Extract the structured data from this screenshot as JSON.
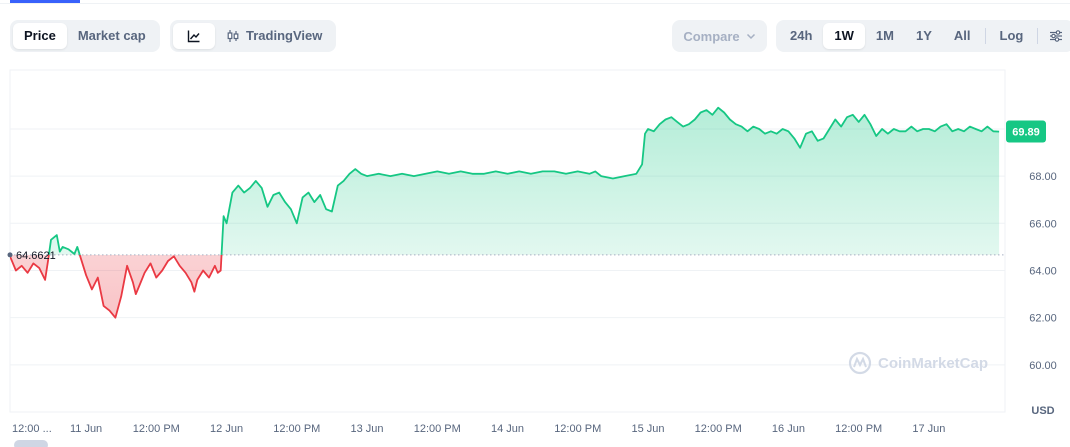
{
  "tabs": [
    {
      "label": "Price",
      "active": true
    },
    {
      "label": "Market cap",
      "active": false
    }
  ],
  "view_buttons": {
    "line_icon": "line-chart-icon",
    "tradingview_icon": "candlestick-icon",
    "tradingview_label": "TradingView"
  },
  "compare": {
    "label": "Compare",
    "icon": "chevron-down-icon"
  },
  "ranges": [
    {
      "label": "24h",
      "active": false
    },
    {
      "label": "1W",
      "active": true
    },
    {
      "label": "1M",
      "active": false
    },
    {
      "label": "1Y",
      "active": false
    },
    {
      "label": "All",
      "active": false
    }
  ],
  "log_label": "Log",
  "settings_icon": "sliders-icon",
  "watermark": "CoinMarketCap",
  "colors": {
    "up": "#16c784",
    "down": "#ea3943",
    "badge": "#16c784",
    "accent": "#3861fb"
  },
  "chart_data": {
    "type": "area",
    "reference_value": 64.6621,
    "reference_label": "64.6621",
    "current_value": 69.89,
    "current_label": "69.89",
    "currency": "USD",
    "ylim": [
      58.0,
      72.5
    ],
    "y_ticks": [
      {
        "value": 60.0,
        "label": "60.00"
      },
      {
        "value": 62.0,
        "label": "62.00"
      },
      {
        "value": 64.0,
        "label": "64.00"
      },
      {
        "value": 66.0,
        "label": "66.00"
      },
      {
        "value": 68.0,
        "label": "68.00"
      }
    ],
    "x_ticks": [
      {
        "x": 0,
        "label": "12:00 ..."
      },
      {
        "x": 12,
        "label": "11 Jun"
      },
      {
        "x": 24,
        "label": "12:00 PM"
      },
      {
        "x": 36,
        "label": "12 Jun"
      },
      {
        "x": 48,
        "label": "12:00 PM"
      },
      {
        "x": 60,
        "label": "13 Jun"
      },
      {
        "x": 72,
        "label": "12:00 PM"
      },
      {
        "x": 84,
        "label": "14 Jun"
      },
      {
        "x": 96,
        "label": "12:00 PM"
      },
      {
        "x": 108,
        "label": "15 Jun"
      },
      {
        "x": 120,
        "label": "12:00 PM"
      },
      {
        "x": 132,
        "label": "16 Jun"
      },
      {
        "x": 144,
        "label": "12:00 PM"
      },
      {
        "x": 156,
        "label": "17 Jun"
      }
    ],
    "xlim": [
      -1,
      169
    ],
    "points": [
      [
        -1.0,
        64.6
      ],
      [
        0.0,
        64.0
      ],
      [
        1.0,
        64.2
      ],
      [
        2.0,
        63.9
      ],
      [
        3.0,
        64.3
      ],
      [
        4.0,
        64.1
      ],
      [
        5.0,
        63.6
      ],
      [
        5.5,
        64.4
      ],
      [
        6.0,
        65.3
      ],
      [
        7.0,
        65.5
      ],
      [
        7.5,
        64.8
      ],
      [
        8.0,
        65.0
      ],
      [
        9.0,
        64.9
      ],
      [
        10.0,
        64.7
      ],
      [
        10.5,
        65.0
      ],
      [
        11.0,
        64.6
      ],
      [
        12.0,
        63.8
      ],
      [
        13.0,
        63.2
      ],
      [
        14.0,
        63.7
      ],
      [
        15.0,
        62.5
      ],
      [
        16.0,
        62.3
      ],
      [
        17.0,
        62.0
      ],
      [
        18.0,
        62.9
      ],
      [
        19.0,
        64.2
      ],
      [
        20.0,
        63.5
      ],
      [
        20.5,
        63.0
      ],
      [
        21.0,
        63.3
      ],
      [
        22.0,
        63.9
      ],
      [
        23.0,
        64.3
      ],
      [
        24.0,
        63.7
      ],
      [
        25.0,
        64.0
      ],
      [
        26.0,
        64.4
      ],
      [
        27.0,
        64.6
      ],
      [
        28.0,
        64.2
      ],
      [
        29.0,
        63.9
      ],
      [
        30.0,
        63.5
      ],
      [
        30.5,
        63.1
      ],
      [
        31.0,
        63.6
      ],
      [
        32.0,
        64.0
      ],
      [
        33.0,
        63.7
      ],
      [
        34.0,
        64.2
      ],
      [
        34.5,
        63.9
      ],
      [
        35.0,
        64.0
      ],
      [
        35.5,
        66.3
      ],
      [
        36.0,
        66.0
      ],
      [
        37.0,
        67.3
      ],
      [
        38.0,
        67.6
      ],
      [
        39.0,
        67.3
      ],
      [
        40.0,
        67.5
      ],
      [
        41.0,
        67.8
      ],
      [
        42.0,
        67.5
      ],
      [
        43.0,
        66.7
      ],
      [
        44.0,
        67.2
      ],
      [
        45.0,
        67.3
      ],
      [
        46.0,
        66.9
      ],
      [
        47.0,
        66.6
      ],
      [
        48.0,
        66.0
      ],
      [
        49.0,
        67.1
      ],
      [
        50.0,
        67.3
      ],
      [
        51.0,
        66.9
      ],
      [
        52.0,
        67.2
      ],
      [
        53.0,
        66.6
      ],
      [
        54.0,
        66.5
      ],
      [
        55.0,
        67.6
      ],
      [
        56.0,
        67.8
      ],
      [
        57.0,
        68.1
      ],
      [
        58.0,
        68.3
      ],
      [
        59.0,
        68.1
      ],
      [
        60.0,
        68.0
      ],
      [
        62.0,
        68.1
      ],
      [
        64.0,
        68.0
      ],
      [
        66.0,
        68.1
      ],
      [
        68.0,
        68.0
      ],
      [
        70.0,
        68.1
      ],
      [
        72.0,
        68.2
      ],
      [
        74.0,
        68.1
      ],
      [
        76.0,
        68.2
      ],
      [
        78.0,
        68.1
      ],
      [
        80.0,
        68.1
      ],
      [
        82.0,
        68.2
      ],
      [
        84.0,
        68.1
      ],
      [
        86.0,
        68.2
      ],
      [
        88.0,
        68.1
      ],
      [
        90.0,
        68.2
      ],
      [
        92.0,
        68.2
      ],
      [
        94.0,
        68.1
      ],
      [
        96.0,
        68.2
      ],
      [
        98.0,
        68.1
      ],
      [
        99.0,
        68.2
      ],
      [
        100.0,
        68.0
      ],
      [
        102.0,
        67.9
      ],
      [
        104.0,
        68.0
      ],
      [
        106.0,
        68.1
      ],
      [
        107.0,
        68.5
      ],
      [
        107.5,
        69.8
      ],
      [
        108.0,
        70.0
      ],
      [
        109.0,
        69.9
      ],
      [
        110.0,
        70.2
      ],
      [
        111.0,
        70.4
      ],
      [
        112.0,
        70.5
      ],
      [
        113.0,
        70.3
      ],
      [
        114.0,
        70.1
      ],
      [
        115.0,
        70.2
      ],
      [
        116.0,
        70.4
      ],
      [
        117.0,
        70.7
      ],
      [
        118.0,
        70.8
      ],
      [
        119.0,
        70.6
      ],
      [
        120.0,
        70.9
      ],
      [
        121.0,
        70.7
      ],
      [
        122.0,
        70.4
      ],
      [
        123.0,
        70.2
      ],
      [
        124.0,
        70.1
      ],
      [
        125.0,
        69.9
      ],
      [
        126.0,
        70.1
      ],
      [
        127.0,
        70.0
      ],
      [
        128.0,
        69.8
      ],
      [
        129.0,
        69.9
      ],
      [
        130.0,
        69.8
      ],
      [
        131.0,
        70.0
      ],
      [
        132.0,
        69.9
      ],
      [
        133.0,
        69.6
      ],
      [
        134.0,
        69.2
      ],
      [
        135.0,
        69.8
      ],
      [
        136.0,
        69.9
      ],
      [
        137.0,
        69.5
      ],
      [
        138.0,
        69.6
      ],
      [
        139.0,
        70.0
      ],
      [
        140.0,
        70.4
      ],
      [
        141.0,
        70.1
      ],
      [
        142.0,
        70.5
      ],
      [
        143.0,
        70.6
      ],
      [
        144.0,
        70.3
      ],
      [
        145.0,
        70.6
      ],
      [
        146.0,
        70.2
      ],
      [
        147.0,
        69.7
      ],
      [
        148.0,
        70.0
      ],
      [
        149.0,
        69.8
      ],
      [
        150.0,
        70.0
      ],
      [
        151.0,
        69.9
      ],
      [
        152.0,
        69.9
      ],
      [
        153.0,
        70.1
      ],
      [
        154.0,
        69.9
      ],
      [
        155.0,
        70.0
      ],
      [
        156.0,
        70.0
      ],
      [
        157.0,
        69.9
      ],
      [
        158.0,
        70.1
      ],
      [
        159.0,
        70.2
      ],
      [
        160.0,
        69.9
      ],
      [
        161.0,
        70.0
      ],
      [
        162.0,
        69.9
      ],
      [
        163.0,
        70.1
      ],
      [
        164.0,
        70.0
      ],
      [
        165.0,
        69.9
      ],
      [
        166.0,
        70.1
      ],
      [
        167.0,
        69.9
      ],
      [
        168.0,
        69.89
      ]
    ]
  }
}
